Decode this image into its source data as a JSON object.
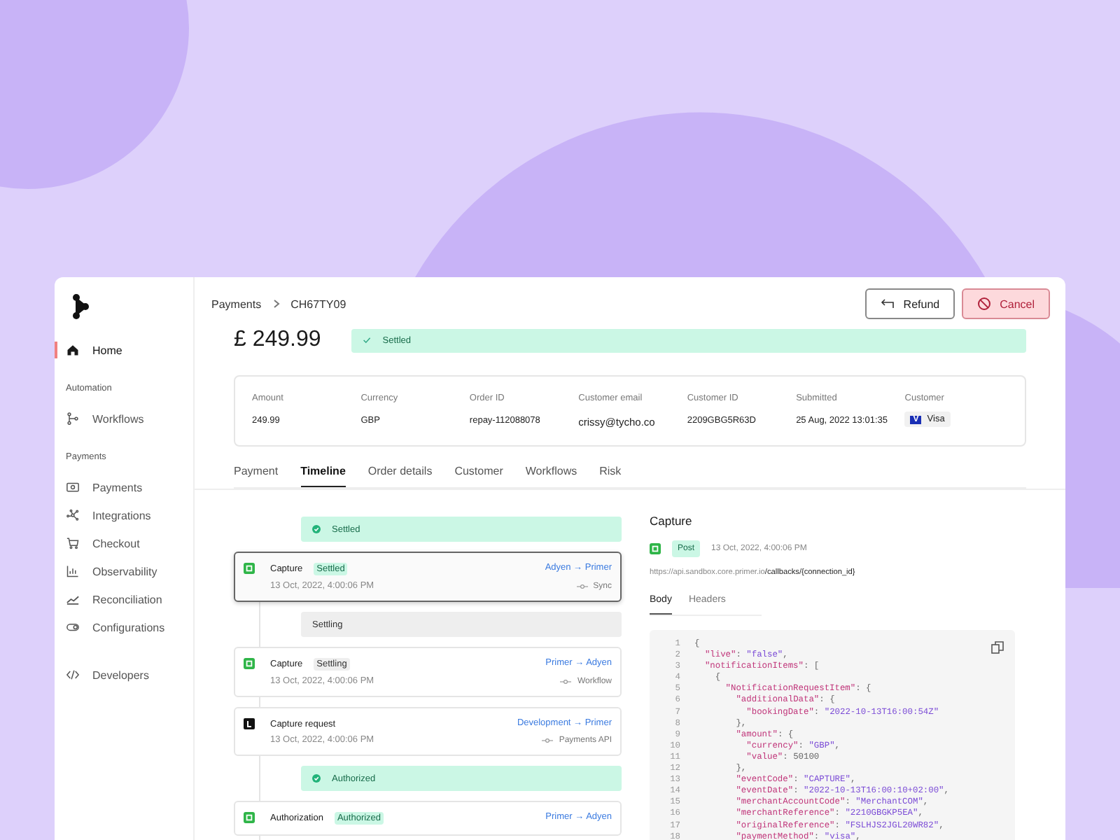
{
  "sidebar": {
    "sections": [
      {
        "items": [
          {
            "label": "Home",
            "selected": true
          }
        ]
      },
      {
        "heading": "Automation",
        "items": [
          {
            "label": "Workflows",
            "selected": false
          }
        ]
      },
      {
        "heading": "Payments",
        "items": [
          {
            "label": "Payments",
            "selected": false
          },
          {
            "label": "Integrations",
            "selected": false
          },
          {
            "label": "Checkout",
            "selected": false
          },
          {
            "label": "Observability",
            "selected": false
          },
          {
            "label": "Reconciliation",
            "selected": false
          },
          {
            "label": "Configurations",
            "selected": false
          }
        ]
      },
      {
        "items": [
          {
            "label": "Developers",
            "selected": false
          }
        ]
      }
    ]
  },
  "breadcrumb": [
    "Payments",
    "CH67TY09"
  ],
  "actions": [
    {
      "label": "Refund",
      "kind": "refund"
    },
    {
      "label": "Cancel",
      "kind": "cancel"
    }
  ],
  "amount": "£ 249.99",
  "status": {
    "label": "Settled"
  },
  "details": [
    {
      "label": "Amount",
      "value": "249.99"
    },
    {
      "label": "Currency",
      "value": "GBP"
    },
    {
      "label": "Order ID",
      "value": "repay-112088078"
    },
    {
      "label": "Customer email",
      "value": "crissy@tycho.co"
    },
    {
      "label": "Customer ID",
      "value": "2209GBG5R63D"
    },
    {
      "label": "Submitted",
      "value": "25 Aug, 2022 13:01:35"
    },
    {
      "label": "Customer",
      "value": "Visa",
      "kind": "card",
      "badge": "V"
    }
  ],
  "tabs": [
    {
      "label": "Payment",
      "selected": false
    },
    {
      "label": "Timeline",
      "selected": true
    },
    {
      "label": "Order details",
      "selected": false
    },
    {
      "label": "Customer",
      "selected": false
    },
    {
      "label": "Workflows",
      "selected": false
    },
    {
      "label": "Risk",
      "selected": false
    }
  ],
  "timeline": [
    {
      "kind": "banner",
      "label": "Settled",
      "complete": true
    },
    {
      "kind": "processor",
      "title": "Capture",
      "badge": "Settled",
      "complete": true,
      "date": "13 Oct, 2022, 4:00:06 PM",
      "route": "Adyen → Primer",
      "via": "Sync",
      "selected": true
    },
    {
      "kind": "banner",
      "label": "Settling",
      "complete": false
    },
    {
      "kind": "processor",
      "title": "Capture",
      "badge": "Settling",
      "complete": false,
      "date": "13 Oct, 2022, 4:00:06 PM",
      "route": "Primer → Adyen",
      "via": "Workflow",
      "selected": false
    },
    {
      "kind": "request",
      "title": "Capture request",
      "date": "13 Oct, 2022, 4:00:06 PM",
      "route": "Development → Primer",
      "via": "Payments API",
      "selected": false
    },
    {
      "kind": "banner",
      "label": "Authorized",
      "complete": true
    },
    {
      "kind": "processor",
      "title": "Authorization",
      "badge": "Authorized",
      "complete": true,
      "route": "Primer → Adyen",
      "selected": false
    }
  ],
  "detail": {
    "title": "Capture",
    "method": "Post",
    "date": "13 Oct, 2022, 4:00:06 PM",
    "url": "https://api.sandbox.core.primer.io**/callbacks/{connection_id}**",
    "tabs": [
      {
        "label": "Body",
        "selected": true
      },
      {
        "label": "Headers",
        "selected": false
      }
    ],
    "code": [
      {
        "n": "1",
        "text": "{"
      },
      {
        "n": "2",
        "text": "  \"live\": \"false\","
      },
      {
        "n": "3",
        "text": "  \"notificationItems\": ["
      },
      {
        "n": "4",
        "text": "    {"
      },
      {
        "n": "5",
        "text": "      \"NotificationRequestItem\": {"
      },
      {
        "n": "6",
        "text": "        \"additionalData\": {"
      },
      {
        "n": "7",
        "text": "          \"bookingDate\": \"2022-10-13T16:00:54Z\""
      },
      {
        "n": "8",
        "text": "        },"
      },
      {
        "n": "9",
        "text": "        \"amount\": {"
      },
      {
        "n": "10",
        "text": "          \"currency\": \"GBP\","
      },
      {
        "n": "11",
        "text": "          \"value\": 50100"
      },
      {
        "n": "12",
        "text": "        },"
      },
      {
        "n": "13",
        "text": "        \"eventCode\": \"CAPTURE\","
      },
      {
        "n": "14",
        "text": "        \"eventDate\": \"2022-10-13T16:00:10+02:00\","
      },
      {
        "n": "15",
        "text": "        \"merchantAccountCode\": \"MerchantCOM\","
      },
      {
        "n": "16",
        "text": "        \"merchantReference\": \"2210GBGKP5EA\","
      },
      {
        "n": "17",
        "text": "        \"originalReference\": \"FSLHJS2JGL20WR82\","
      },
      {
        "n": "18",
        "text": "        \"paymentMethod\": \"visa\","
      }
    ]
  }
}
